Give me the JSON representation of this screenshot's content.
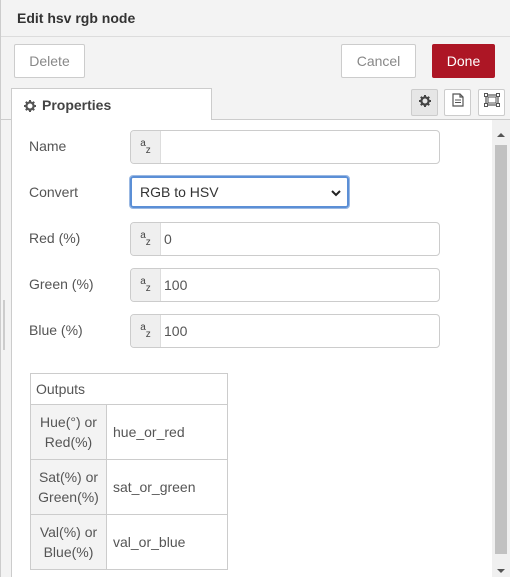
{
  "tray": {
    "title": "Edit hsv rgb node"
  },
  "toolbar": {
    "delete_label": "Delete",
    "cancel_label": "Cancel",
    "done_label": "Done"
  },
  "tabs": {
    "properties_label": "Properties",
    "icons": [
      "gear-icon",
      "description-icon",
      "appearance-icon"
    ]
  },
  "form": {
    "name": {
      "label": "Name",
      "value": ""
    },
    "convert": {
      "label": "Convert",
      "selected": "RGB to HSV"
    },
    "red": {
      "label": "Red (%)",
      "value": "0"
    },
    "green": {
      "label": "Green (%)",
      "value": "100"
    },
    "blue": {
      "label": "Blue (%)",
      "value": "100"
    }
  },
  "outputs": {
    "header": "Outputs",
    "rows": [
      {
        "label_line1": "Hue(°) or",
        "label_line2": "Red(%)",
        "value": "hue_or_red"
      },
      {
        "label_line1": "Sat(%) or",
        "label_line2": "Green(%)",
        "value": "sat_or_green"
      },
      {
        "label_line1": "Val(%) or",
        "label_line2": "Blue(%)",
        "value": "val_or_blue"
      }
    ]
  },
  "colors": {
    "done_button": "#ad1625",
    "select_focus": "#5b8fd6"
  }
}
